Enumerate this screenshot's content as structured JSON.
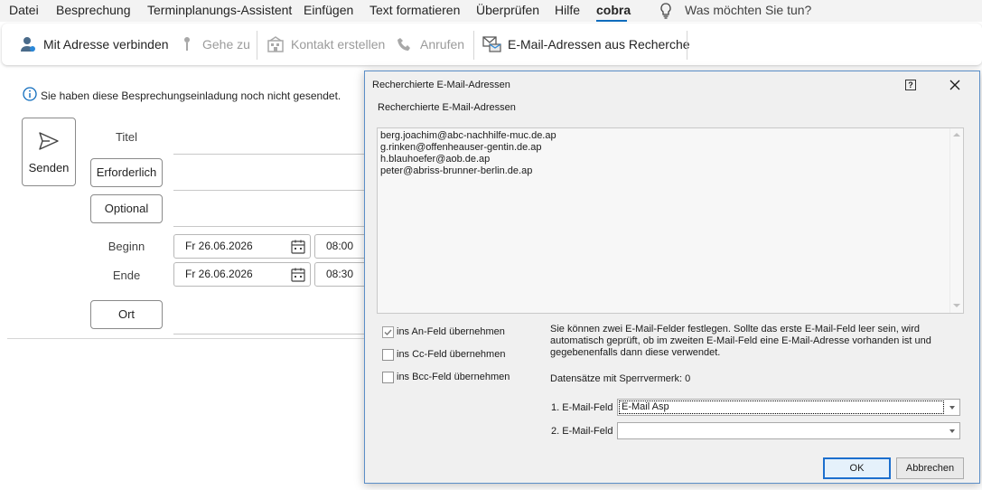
{
  "menubar": {
    "items": [
      {
        "label": "Datei",
        "active": false
      },
      {
        "label": "Besprechung",
        "active": false
      },
      {
        "label": "Terminplanungs-Assistent",
        "active": false
      },
      {
        "label": "Einfügen",
        "active": false
      },
      {
        "label": "Text formatieren",
        "active": false
      },
      {
        "label": "Überprüfen",
        "active": false
      },
      {
        "label": "Hilfe",
        "active": false
      },
      {
        "label": "cobra",
        "active": true
      }
    ],
    "tell_me": {
      "icon": "lightbulb-icon",
      "text": "Was möchten Sie tun?"
    }
  },
  "ribbon": {
    "buttons": [
      {
        "label": "Mit Adresse verbinden",
        "icon": "person-link-icon",
        "enabled": true
      },
      {
        "label": "Gehe zu",
        "icon": "pin-icon",
        "enabled": false
      },
      {
        "label": "Kontakt erstellen",
        "icon": "building-icon",
        "enabled": false
      },
      {
        "label": "Anrufen",
        "icon": "phone-icon",
        "enabled": false
      },
      {
        "label": "E-Mail-Adressen aus Recherche",
        "icon": "email-search-icon",
        "enabled": true
      }
    ]
  },
  "compose": {
    "info": "Sie haben diese Besprechungseinladung noch nicht gesendet.",
    "send_label": "Senden",
    "title_label": "Titel",
    "required_label": "Erforderlich",
    "optional_label": "Optional",
    "start_label": "Beginn",
    "end_label": "Ende",
    "start_date": "Fr 26.06.2026",
    "start_time": "08:00",
    "end_date": "Fr 26.06.2026",
    "end_time": "08:30",
    "location_label": "Ort"
  },
  "dialog": {
    "title": "Recherchierte E-Mail-Adressen",
    "group_label": "Recherchierte E-Mail-Adressen",
    "emails": [
      "berg.joachim@abc-nachhilfe-muc.de.ap",
      "g.rinken@offenheauser-gentin.de.ap",
      "h.blauhoefer@aob.de.ap",
      "peter@abriss-brunner-berlin.de.ap"
    ],
    "checkboxes": [
      {
        "label": "ins An-Feld übernehmen",
        "checked": true
      },
      {
        "label": "ins Cc-Feld übernehmen",
        "checked": false
      },
      {
        "label": "ins Bcc-Feld übernehmen",
        "checked": false
      }
    ],
    "info_text": "Sie können zwei E-Mail-Felder festlegen. Sollte das erste E-Mail-Feld leer sein, wird automatisch geprüft, ob im zweiten E-Mail-Feld eine E-Mail-Adresse vorhanden ist und gegebenenfalls dann diese verwendet.",
    "blocked_records": "Datensätze mit Sperrvermerk: 0",
    "field1_label": "1. E-Mail-Feld",
    "field1_value": "E-Mail Asp",
    "field2_label": "2. E-Mail-Feld",
    "field2_value": "",
    "ok_label": "OK",
    "cancel_label": "Abbrechen"
  }
}
